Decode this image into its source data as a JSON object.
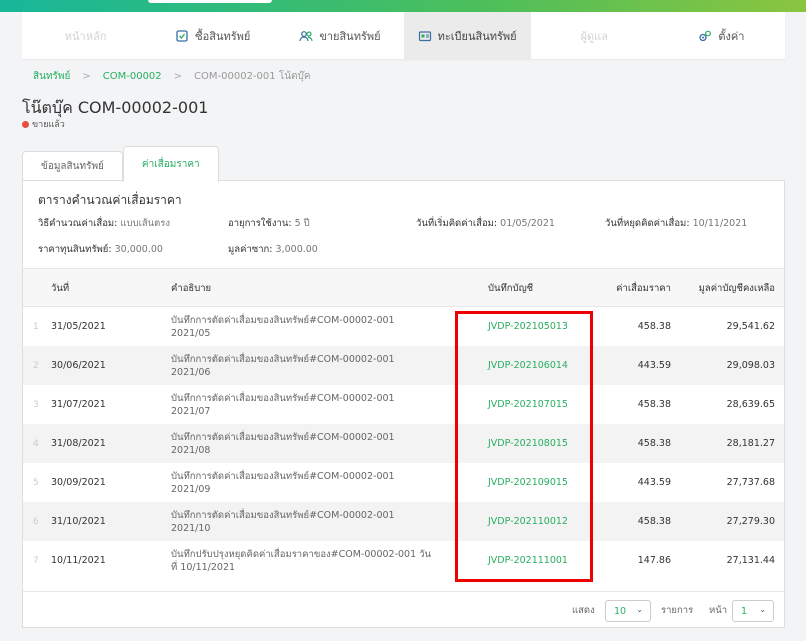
{
  "nav": {
    "items": [
      {
        "label": "หน้าหลัก",
        "icon": "home-icon",
        "state": "disabled"
      },
      {
        "label": "ซื้อสินทรัพย์",
        "icon": "cart-icon",
        "state": "normal"
      },
      {
        "label": "ขายสินทรัพย์",
        "icon": "users-icon",
        "state": "normal"
      },
      {
        "label": "ทะเบียนสินทรัพย์",
        "icon": "register-icon",
        "state": "active"
      },
      {
        "label": "ผู้ดูแล",
        "icon": "person-icon",
        "state": "disabled"
      },
      {
        "label": "ตั้งค่า",
        "icon": "gear-icon",
        "state": "normal"
      }
    ]
  },
  "breadcrumb": {
    "root": "สินทรัพย์",
    "parent": "COM-00002",
    "current": "COM-00002-001 โน้ตบุ๊ค"
  },
  "page": {
    "title": "โน๊ตบุ๊ค COM-00002-001",
    "status": "ขายแล้ว",
    "status_color": "#e74c3c"
  },
  "tabs": {
    "info": "ข้อมูลสินทรัพย์",
    "depreciation": "ค่าเสื่อมราคา"
  },
  "card": {
    "title": "ตารางคำนวณค่าเสื่อมราคา",
    "method_label": "วิธีคำนวณค่าเสื่อม:",
    "method_value": "แบบเส้นตรง",
    "life_label": "อายุการใช้งาน:",
    "life_value": "5 ปี",
    "start_label": "วันที่เริ่มคิดค่าเสื่อม:",
    "start_value": "01/05/2021",
    "stop_label": "วันที่หยุดคิดค่าเสื่อม:",
    "stop_value": "10/11/2021",
    "cost_label": "ราคาทุนสินทรัพย์:",
    "cost_value": "30,000.00",
    "salvage_label": "มูลค่าซาก:",
    "salvage_value": "3,000.00"
  },
  "table": {
    "headers": {
      "date": "วันที่",
      "desc": "คำอธิบาย",
      "ref": "บันทึกบัญชี",
      "dep": "ค่าเสื่อมราคา",
      "book": "มูลค่าบัญชีคงเหลือ"
    },
    "rows": [
      {
        "n": "1",
        "date": "31/05/2021",
        "desc": "บันทึกการตัดค่าเสื่อมของสินทรัพย์#COM-00002-001 2021/05",
        "ref": "JVDP-202105013",
        "dep": "458.38",
        "book": "29,541.62"
      },
      {
        "n": "2",
        "date": "30/06/2021",
        "desc": "บันทึกการตัดค่าเสื่อมของสินทรัพย์#COM-00002-001 2021/06",
        "ref": "JVDP-202106014",
        "dep": "443.59",
        "book": "29,098.03"
      },
      {
        "n": "3",
        "date": "31/07/2021",
        "desc": "บันทึกการตัดค่าเสื่อมของสินทรัพย์#COM-00002-001 2021/07",
        "ref": "JVDP-202107015",
        "dep": "458.38",
        "book": "28,639.65"
      },
      {
        "n": "4",
        "date": "31/08/2021",
        "desc": "บันทึกการตัดค่าเสื่อมของสินทรัพย์#COM-00002-001 2021/08",
        "ref": "JVDP-202108015",
        "dep": "458.38",
        "book": "28,181.27"
      },
      {
        "n": "5",
        "date": "30/09/2021",
        "desc": "บันทึกการตัดค่าเสื่อมของสินทรัพย์#COM-00002-001 2021/09",
        "ref": "JVDP-202109015",
        "dep": "443.59",
        "book": "27,737.68"
      },
      {
        "n": "6",
        "date": "31/10/2021",
        "desc": "บันทึกการตัดค่าเสื่อมของสินทรัพย์#COM-00002-001 2021/10",
        "ref": "JVDP-202110012",
        "dep": "458.38",
        "book": "27,279.30"
      },
      {
        "n": "7",
        "date": "10/11/2021",
        "desc": "บันทึกปรับปรุงหยุดคิดค่าเสื่อมราคาของ#COM-00002-001 วันที่ 10/11/2021",
        "ref": "JVDP-202111001",
        "dep": "147.86",
        "book": "27,131.44"
      }
    ]
  },
  "footer": {
    "rows_label": "แสดง",
    "rows_value": "10",
    "items_label": "รายการ",
    "page_label": "หน้า",
    "page_value": "1"
  },
  "colors": {
    "accent": "#27ae60",
    "highlight": "#e00000"
  }
}
